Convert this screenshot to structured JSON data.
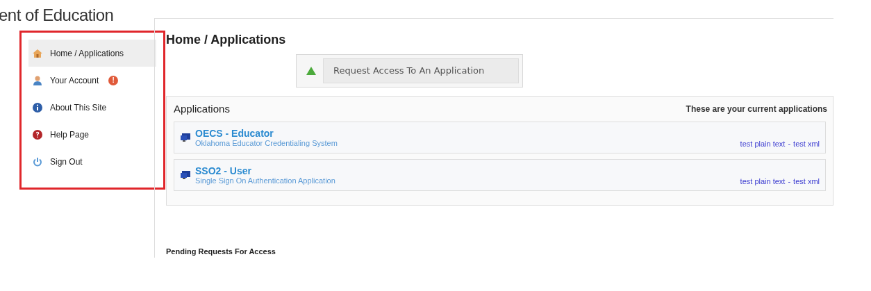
{
  "header": {
    "title": "ent of Education"
  },
  "sidebar": {
    "items": [
      {
        "label": "Home / Applications",
        "kind": "home",
        "selected": true
      },
      {
        "label": "Your Account",
        "kind": "account",
        "selected": false,
        "badge": "!"
      },
      {
        "label": "About This Site",
        "kind": "info",
        "selected": false
      },
      {
        "label": "Help Page",
        "kind": "help",
        "selected": false
      },
      {
        "label": "Sign Out",
        "kind": "signout",
        "selected": false
      }
    ]
  },
  "page_title": "Home / Applications",
  "request_button": "Request Access To An Application",
  "applications": {
    "title": "Applications",
    "subtitle": "These are your current applications",
    "rows": [
      {
        "name": "OECS - Educator",
        "description": "Oklahoma Educator Credentialing System",
        "links": [
          "test plain text",
          "test xml"
        ],
        "separator": "-"
      },
      {
        "name": "SSO2 - User",
        "description": "Single Sign On Authentication Application",
        "links": [
          "test plain text",
          "test xml"
        ],
        "separator": "-"
      }
    ]
  },
  "pending": {
    "title": "Pending Requests For Access"
  }
}
